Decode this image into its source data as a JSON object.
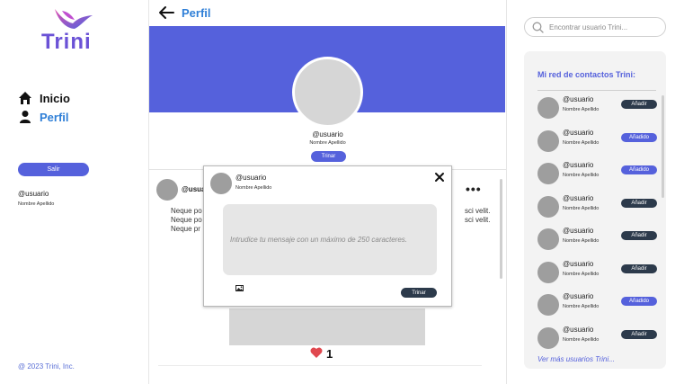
{
  "brand": {
    "name": "Trini",
    "color_primary": "#5561dc",
    "color_link": "#2f7fd7"
  },
  "sidebar": {
    "nav": [
      {
        "label": "Inicio",
        "icon": "home-icon"
      },
      {
        "label": "Perfil",
        "icon": "user-icon"
      }
    ],
    "logout_label": "Salir",
    "user": {
      "handle": "@usuario",
      "name": "Nombre Apellido"
    },
    "copyright": "@ 2023 Trini, Inc."
  },
  "header": {
    "back_icon": "arrow-left-icon",
    "title": "Perfil"
  },
  "profile": {
    "handle": "@usuario",
    "name": "Nombre Apellido",
    "trinar_label": "Trinar"
  },
  "post": {
    "handle": "@usua",
    "more_icon": "ellipsis-icon",
    "lines_left": [
      "Neque po",
      "Neque po",
      "Neque pr"
    ],
    "lines_right": [
      "sci velit.",
      "sci velit."
    ],
    "likes": "1",
    "like_icon": "heart-icon"
  },
  "modal": {
    "handle": "@usuario",
    "name": "Nombre Apellido",
    "close_icon": "close-icon",
    "placeholder": "Intrudice tu mensaje con un máximo de 250 caracteres.",
    "image_icon": "image-icon",
    "submit_label": "Trinar"
  },
  "right": {
    "search_placeholder": "Encontrar usuario Trini...",
    "contacts_title": "Mi red de contactos Trini:",
    "contacts": [
      {
        "handle": "@usuario",
        "name": "Nombre Apellido",
        "action": "Añadir",
        "state": "add"
      },
      {
        "handle": "@usuario",
        "name": "Nombre Apellido",
        "action": "Añadido",
        "state": "added"
      },
      {
        "handle": "@usuario",
        "name": "Nombre Apellido",
        "action": "Añadido",
        "state": "added"
      },
      {
        "handle": "@usuario",
        "name": "Nombre Apellido",
        "action": "Añadir",
        "state": "add"
      },
      {
        "handle": "@usuario",
        "name": "Nombre Apellido",
        "action": "Añadir",
        "state": "add"
      },
      {
        "handle": "@usuario",
        "name": "Nombre Apellido",
        "action": "Añadir",
        "state": "add"
      },
      {
        "handle": "@usuario",
        "name": "Nombre Apellido",
        "action": "Añadido",
        "state": "added"
      },
      {
        "handle": "@usuario",
        "name": "Nombre Apellido",
        "action": "Añadir",
        "state": "add"
      }
    ],
    "more_link": "Ver más usuarios Trini...",
    "colors": {
      "add": "#2c3a4b",
      "added": "#5561dc"
    }
  }
}
